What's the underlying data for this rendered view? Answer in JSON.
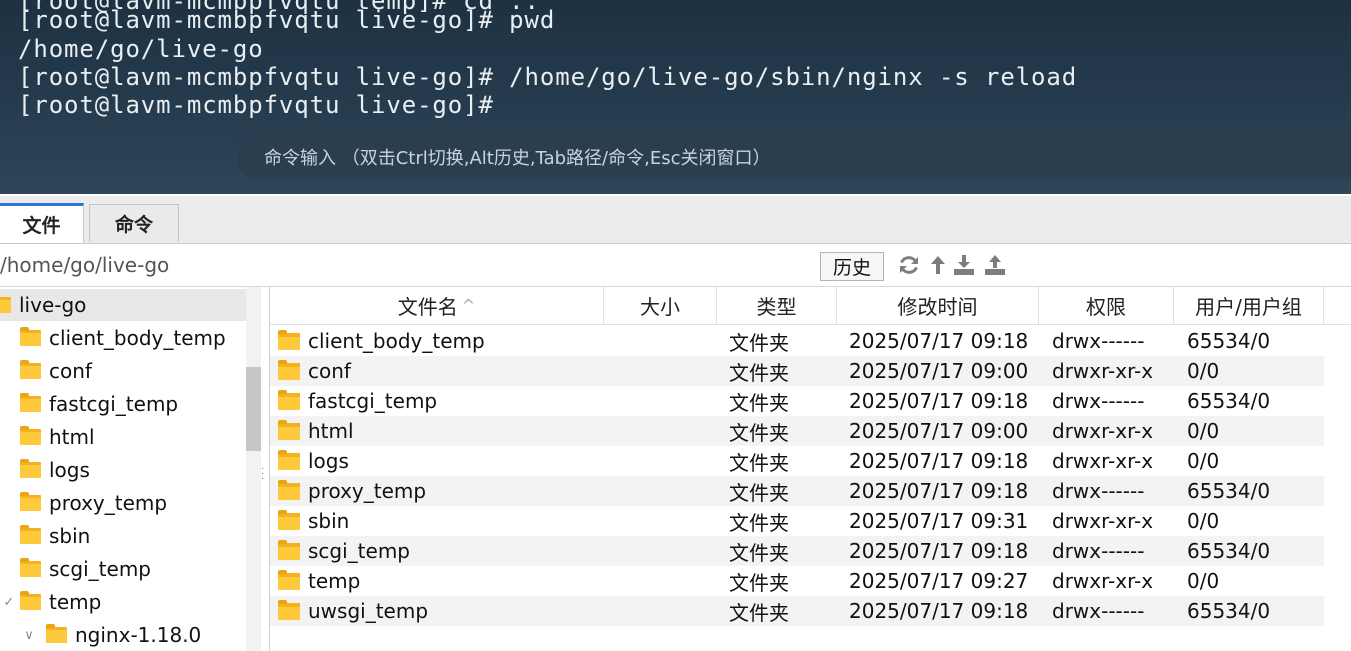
{
  "terminal": {
    "lines": [
      "[root@lavm-mcmbpfvqtu temp]# cd ..",
      "[root@lavm-mcmbpfvqtu live-go]# pwd",
      "/home/go/live-go",
      "[root@lavm-mcmbpfvqtu live-go]# /home/go/live-go/sbin/nginx -s reload",
      "[root@lavm-mcmbpfvqtu live-go]#"
    ],
    "command_input_hint": "命令输入 （双击Ctrl切换,Alt历史,Tab路径/命令,Esc关闭窗口）",
    "grip": "···"
  },
  "tabs": [
    {
      "label": "文件",
      "active": true
    },
    {
      "label": "命令",
      "active": false
    }
  ],
  "pathbar": {
    "path": "/home/go/live-go",
    "history_label": "历史",
    "icons": [
      "refresh-icon",
      "up-icon",
      "download-icon",
      "upload-icon"
    ]
  },
  "tree": {
    "root": "live-go",
    "items": [
      {
        "label": "client_body_temp"
      },
      {
        "label": "conf"
      },
      {
        "label": "fastcgi_temp"
      },
      {
        "label": "html"
      },
      {
        "label": "logs"
      },
      {
        "label": "proxy_temp"
      },
      {
        "label": "sbin"
      },
      {
        "label": "scgi_temp"
      },
      {
        "label": "temp",
        "expanded": true
      },
      {
        "label": "nginx-1.18.0",
        "child": true
      }
    ],
    "expand_caret": "✓",
    "child_caret": "∨"
  },
  "filelist": {
    "columns": {
      "name": "文件名",
      "size": "大小",
      "type": "类型",
      "mtime": "修改时间",
      "perm": "权限",
      "owner": "用户/用户组"
    },
    "sort_indicator": "^",
    "rows": [
      {
        "name": "client_body_temp",
        "type": "文件夹",
        "mtime": "2025/07/17 09:18",
        "perm": "drwx------",
        "owner": "65534/0"
      },
      {
        "name": "conf",
        "type": "文件夹",
        "mtime": "2025/07/17 09:00",
        "perm": "drwxr-xr-x",
        "owner": "0/0"
      },
      {
        "name": "fastcgi_temp",
        "type": "文件夹",
        "mtime": "2025/07/17 09:18",
        "perm": "drwx------",
        "owner": "65534/0"
      },
      {
        "name": "html",
        "type": "文件夹",
        "mtime": "2025/07/17 09:00",
        "perm": "drwxr-xr-x",
        "owner": "0/0"
      },
      {
        "name": "logs",
        "type": "文件夹",
        "mtime": "2025/07/17 09:18",
        "perm": "drwxr-xr-x",
        "owner": "0/0"
      },
      {
        "name": "proxy_temp",
        "type": "文件夹",
        "mtime": "2025/07/17 09:18",
        "perm": "drwx------",
        "owner": "65534/0"
      },
      {
        "name": "sbin",
        "type": "文件夹",
        "mtime": "2025/07/17 09:31",
        "perm": "drwxr-xr-x",
        "owner": "0/0"
      },
      {
        "name": "scgi_temp",
        "type": "文件夹",
        "mtime": "2025/07/17 09:18",
        "perm": "drwx------",
        "owner": "65534/0"
      },
      {
        "name": "temp",
        "type": "文件夹",
        "mtime": "2025/07/17 09:27",
        "perm": "drwxr-xr-x",
        "owner": "0/0"
      },
      {
        "name": "uwsgi_temp",
        "type": "文件夹",
        "mtime": "2025/07/17 09:18",
        "perm": "drwx------",
        "owner": "65534/0"
      }
    ]
  },
  "colors": {
    "terminal_bg": "#243a4c",
    "folder": "#ffc93c",
    "active_tab_accent": "#2d76d4"
  }
}
